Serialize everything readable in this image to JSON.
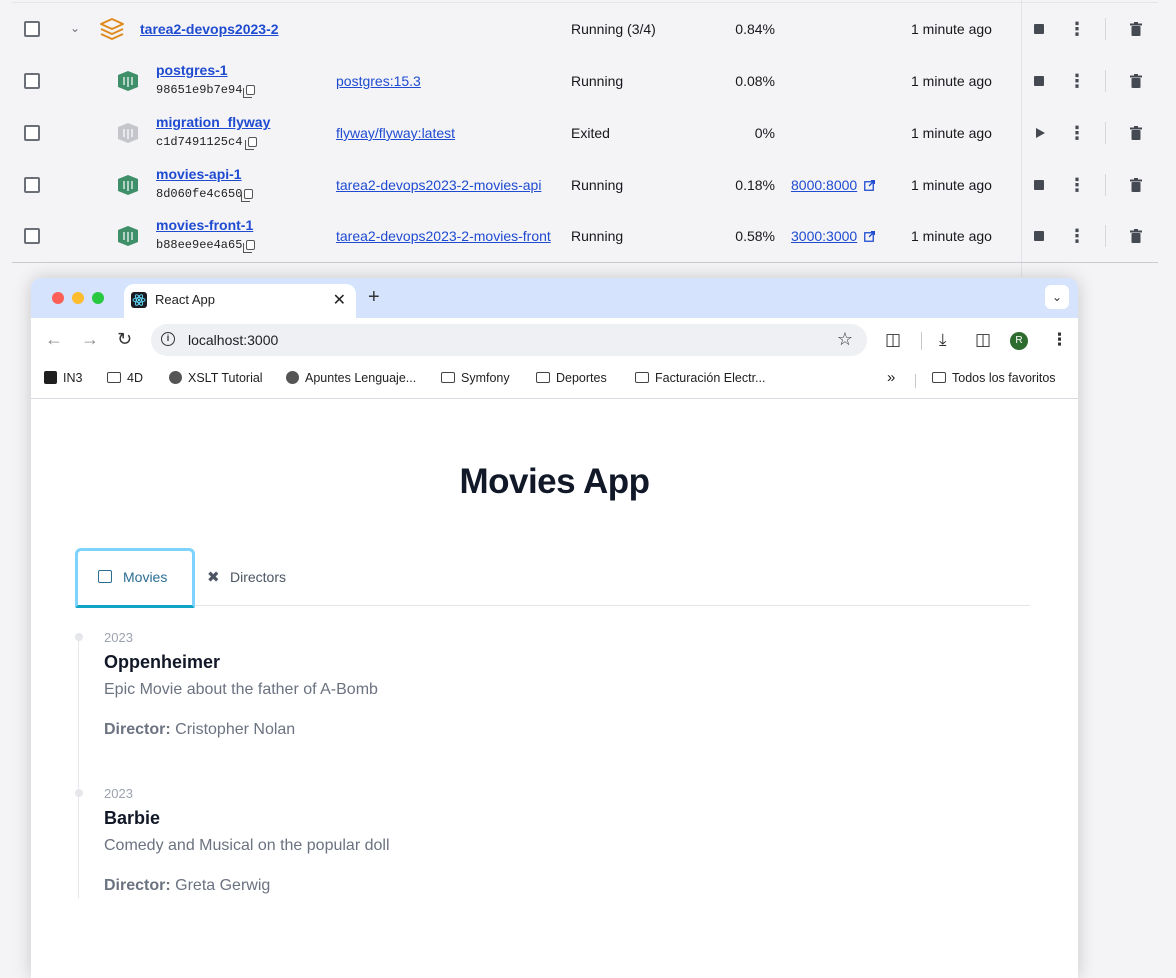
{
  "docker": {
    "stack": {
      "name": "tarea2-devops2023-2",
      "status": "Running (3/4)",
      "cpu": "0.84%",
      "time": "1 minute ago"
    },
    "containers": [
      {
        "name": "postgres-1",
        "id": "98651e9b7e94",
        "image": "postgres:15.3",
        "status": "Running",
        "cpu": "0.08%",
        "port": "",
        "time": "1 minute ago",
        "state": "running"
      },
      {
        "name": "migration_flyway",
        "id": "c1d7491125c4",
        "image": "flyway/flyway:latest",
        "status": "Exited",
        "cpu": "0%",
        "port": "",
        "time": "1 minute ago",
        "state": "exited"
      },
      {
        "name": "movies-api-1",
        "id": "8d060fe4c650",
        "image": "tarea2-devops2023-2-movies-api",
        "status": "Running",
        "cpu": "0.18%",
        "port": "8000:8000",
        "time": "1 minute ago",
        "state": "running"
      },
      {
        "name": "movies-front-1",
        "id": "b88ee9ee4a65",
        "image": "tarea2-devops2023-2-movies-front",
        "status": "Running",
        "cpu": "0.58%",
        "port": "3000:3000",
        "time": "1 minute ago",
        "state": "running"
      }
    ],
    "colors": {
      "link": "#1f4bd1",
      "stack_icon": "#e08a1e",
      "container_icon": "#3f8f6b",
      "container_icon_exited": "#c4c6cc"
    }
  },
  "browser": {
    "tab_title": "React App",
    "url": "localhost:3000",
    "avatar_initial": "R",
    "bookmarks": [
      "IN3",
      "4D",
      "XSLT Tutorial",
      "Apuntes Lenguaje...",
      "Symfony",
      "Deportes",
      "Facturación Electr..."
    ],
    "all_bookmarks": "Todos los favoritos",
    "icons": [
      "back-icon",
      "forward-icon",
      "reload-icon",
      "info-icon",
      "star-icon",
      "extensions-icon",
      "download-icon",
      "sidebar-icon",
      "menu-icon"
    ]
  },
  "app": {
    "title": "Movies App",
    "tabs": [
      {
        "label": "Movies",
        "active": true
      },
      {
        "label": "Directors",
        "active": false
      }
    ],
    "director_label": "Director:",
    "movies": [
      {
        "year": "2023",
        "title": "Oppenheimer",
        "description": "Epic Movie about the father of A-Bomb",
        "director": "Cristopher Nolan"
      },
      {
        "year": "2023",
        "title": "Barbie",
        "description": "Comedy and Musical on the popular doll",
        "director": "Greta Gerwig"
      }
    ],
    "colors": {
      "active_tab": "#2b6d93",
      "active_border": "#7dd3fc"
    }
  }
}
